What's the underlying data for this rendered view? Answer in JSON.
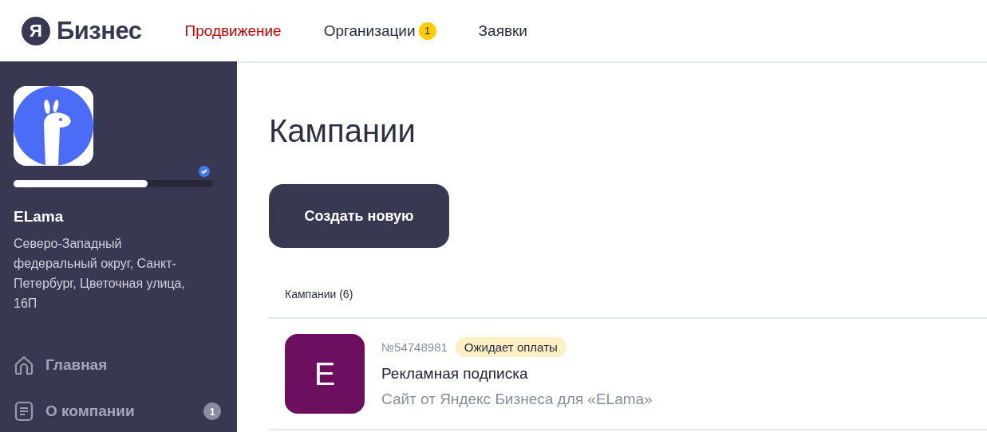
{
  "header": {
    "logo_mark": "Я",
    "logo_text": "Бизнес",
    "tabs": [
      {
        "label": "Продвижение",
        "selected": true
      },
      {
        "label": "Организации",
        "selected": false,
        "badge": "1"
      },
      {
        "label": "Заявки",
        "selected": false
      }
    ]
  },
  "sidebar": {
    "level": 0.67,
    "verified": true,
    "name": "ELama",
    "address": "Северо-Западный федеральный округ, Санкт-Петербург, Цветочная улица, 16П",
    "items": [
      {
        "kind": "home",
        "label": "Главная"
      },
      {
        "kind": "document",
        "label": "О компании",
        "badge": "1"
      }
    ]
  },
  "page": {
    "title": "Кампании",
    "create_button": "Создать новую",
    "list_heading": "Кампании (6)",
    "campaigns": [
      {
        "letter": "E",
        "color": "#6b0f5e",
        "number": "№54748981",
        "status": "Ожидает оплаты",
        "title": "Рекламная подписка",
        "subtitle": "Сайт от Яндекс Бизнеса для «ELama»"
      }
    ]
  }
}
